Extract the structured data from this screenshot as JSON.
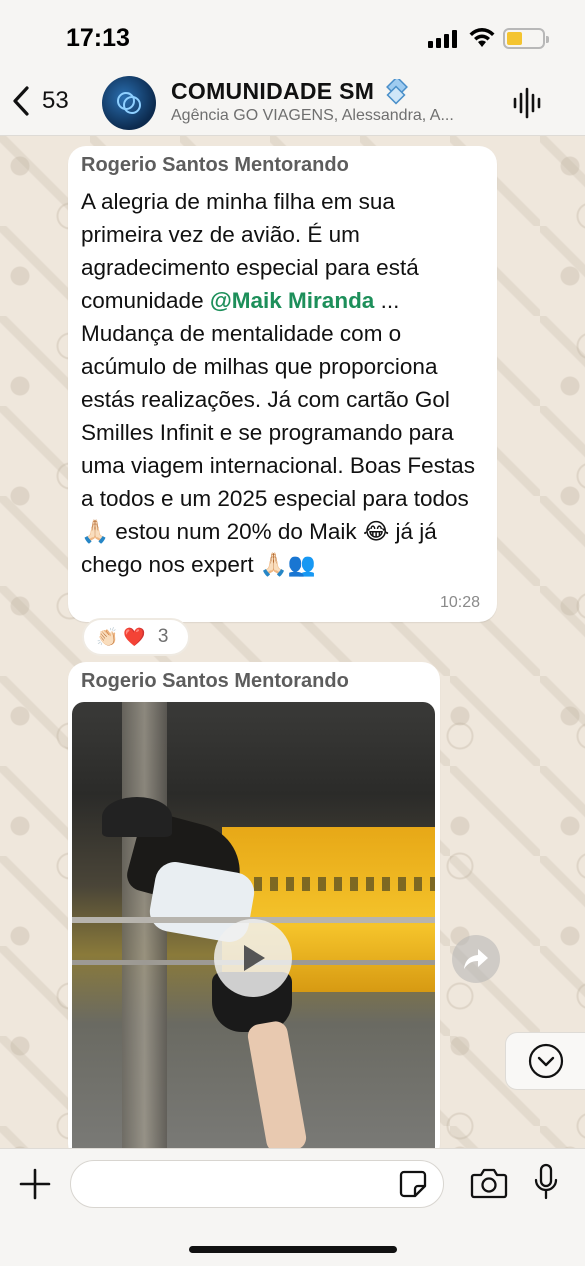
{
  "status_bar": {
    "time": "17:13"
  },
  "header": {
    "back_count": "53",
    "title": "COMUNIDADE SM",
    "subtitle": "Agência GO VIAGENS, Alessandra, A..."
  },
  "messages": [
    {
      "sender": "Rogerio Santos Mentorando",
      "text_before": "A alegria de minha filha em sua primeira vez de avião. É um agradecimento especial para está comunidade ",
      "mention": "@Maik Miranda",
      "text_after": " ... Mudança de mentalidade com o acúmulo de milhas que proporciona estás realizações. Já com cartão Gol Smilles Infinit e se programando para uma viagem internacional. Boas Festas a todos e um 2025 especial para todos 🙏🏻 estou num 20% do Maik 😂 já já chego nos expert 🙏🏻👥",
      "time": "10:28",
      "reactions": {
        "emojis": "👏🏻 ❤️",
        "count": "3"
      }
    },
    {
      "sender": "Rogerio Santos Mentorando",
      "media": "video"
    }
  ],
  "composer": {
    "placeholder": ""
  },
  "icons": {
    "back": "chevron-left-icon",
    "audio": "waveform-icon",
    "play": "play-icon",
    "forward": "forward-icon",
    "scroll": "chevron-down-icon",
    "plus": "plus-icon",
    "sticker": "sticker-icon",
    "camera": "camera-icon",
    "mic": "microphone-icon"
  },
  "colors": {
    "mention": "#1d8f5a",
    "battery": "#f4c430"
  }
}
